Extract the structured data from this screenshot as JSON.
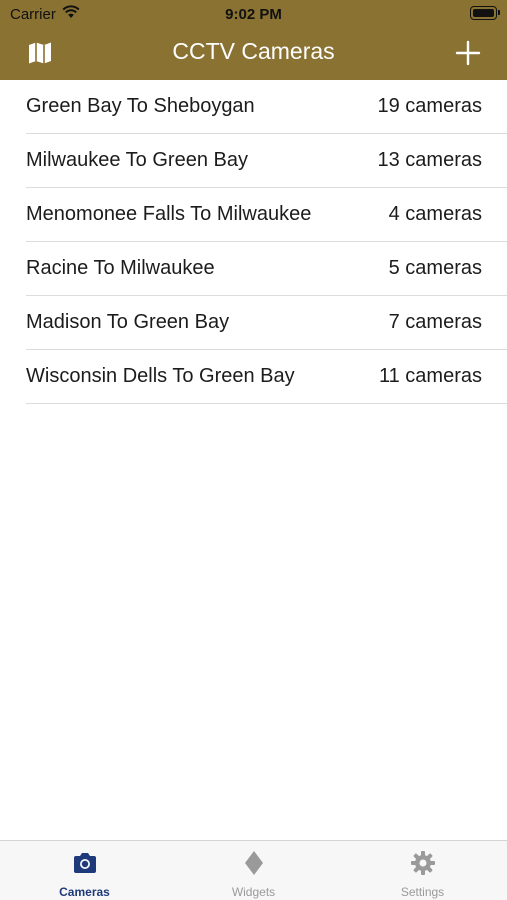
{
  "status_bar": {
    "carrier": "Carrier",
    "time": "9:02 PM",
    "icons": [
      "wifi-icon",
      "battery-icon"
    ]
  },
  "nav": {
    "title": "CCTV Cameras",
    "left_icon": "map-icon",
    "right_icon": "plus-icon",
    "bar_color": "#8a7232"
  },
  "routes": [
    {
      "name": "Green Bay To Sheboygan",
      "count": "19 cameras"
    },
    {
      "name": "Milwaukee To Green Bay",
      "count": "13 cameras"
    },
    {
      "name": "Menomonee Falls To Milwaukee",
      "count": "4 cameras"
    },
    {
      "name": "Racine To Milwaukee",
      "count": "5 cameras"
    },
    {
      "name": "Madison To Green Bay",
      "count": "7 cameras"
    },
    {
      "name": "Wisconsin Dells To Green Bay",
      "count": "11 cameras"
    }
  ],
  "tabbar": {
    "active_color": "#1f3a7a",
    "inactive_color": "#9a9a9a",
    "tabs": [
      {
        "label": "Cameras",
        "icon": "camera-icon",
        "active": true
      },
      {
        "label": "Widgets",
        "icon": "diamond-icon",
        "active": false
      },
      {
        "label": "Settings",
        "icon": "gear-icon",
        "active": false
      }
    ]
  }
}
